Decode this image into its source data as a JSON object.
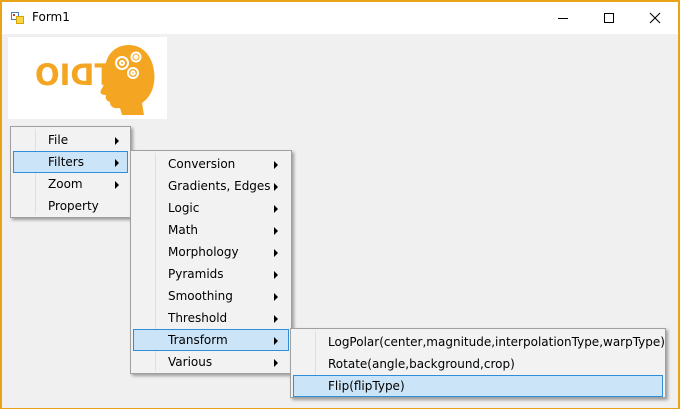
{
  "window": {
    "title": "Form1",
    "accent_color": "#e8a317",
    "icons": {
      "app": "form-app-icon",
      "minimize": "minimize-icon",
      "maximize": "maximize-icon",
      "close": "close-icon"
    }
  },
  "logo": {
    "text": "STDIO",
    "color": "#f4a622",
    "icon": "head-with-gears-logo"
  },
  "menu_main": {
    "items": [
      {
        "label": "File",
        "has_submenu": true
      },
      {
        "label": "Filters",
        "has_submenu": true,
        "active": true
      },
      {
        "label": "Zoom",
        "has_submenu": true
      },
      {
        "label": "Property",
        "has_submenu": false
      }
    ]
  },
  "menu_filters": {
    "items": [
      {
        "label": "Conversion"
      },
      {
        "label": "Gradients, Edges"
      },
      {
        "label": "Logic"
      },
      {
        "label": "Math"
      },
      {
        "label": "Morphology"
      },
      {
        "label": "Pyramids"
      },
      {
        "label": "Smoothing"
      },
      {
        "label": "Threshold"
      },
      {
        "label": "Transform",
        "active": true
      },
      {
        "label": "Various"
      }
    ]
  },
  "menu_transform": {
    "items": [
      {
        "label": "LogPolar(center,magnitude,interpolationType,warpType)"
      },
      {
        "label": "Rotate(angle,background,crop)"
      },
      {
        "label": "Flip(flipType)",
        "active": true
      }
    ]
  },
  "colors": {
    "highlight_bg": "#cce4f7",
    "highlight_border": "#2f8ed5",
    "menu_bg": "#f2f2f2"
  }
}
